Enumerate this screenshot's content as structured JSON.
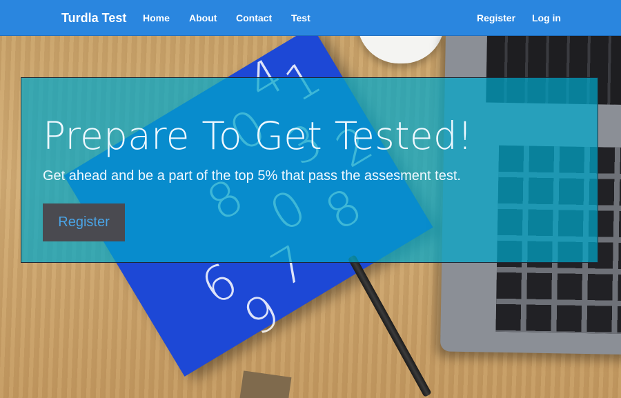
{
  "navbar": {
    "brand": "Turdla Test",
    "links": [
      "Home",
      "About",
      "Contact",
      "Test"
    ],
    "right_links": [
      "Register",
      "Log in"
    ]
  },
  "hero": {
    "title": "Prepare To Get Tested!",
    "subtitle": "Get ahead and be a part of the top 5% that pass the assesment test.",
    "button_label": "Register"
  },
  "background": {
    "book_numbers": [
      "4",
      "1",
      "0",
      "3",
      "2",
      "8",
      "0",
      "8",
      "7",
      "6",
      "9"
    ]
  },
  "colors": {
    "navbar": "#2a86df",
    "hero_overlay": "#00a6c9",
    "book": "#1d48d6",
    "button_bg": "#4a4a50",
    "button_text": "#4aa4e6"
  }
}
